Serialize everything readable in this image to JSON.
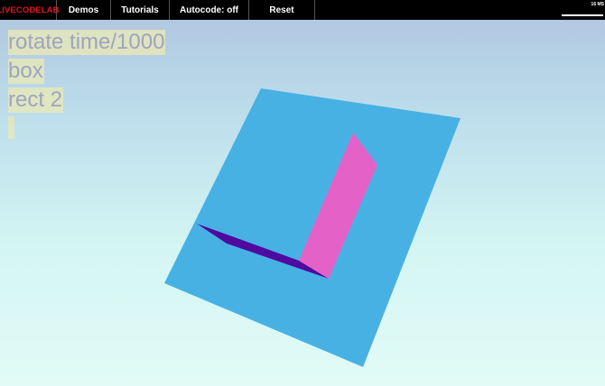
{
  "menu": {
    "brand": "LIVECODELAB",
    "demos": "Demos",
    "tutorials": "Tutorials",
    "autocode": "Autocode: off",
    "reset": "Reset"
  },
  "stats": {
    "text": "16 MS"
  },
  "editor": {
    "lines": [
      "rotate time/1000",
      "box",
      "rect 2"
    ]
  },
  "colors": {
    "rect": "#48b1e4",
    "box_front": "#e462c7",
    "box_top": "#4f0a9f",
    "brand": "#e8141e"
  }
}
